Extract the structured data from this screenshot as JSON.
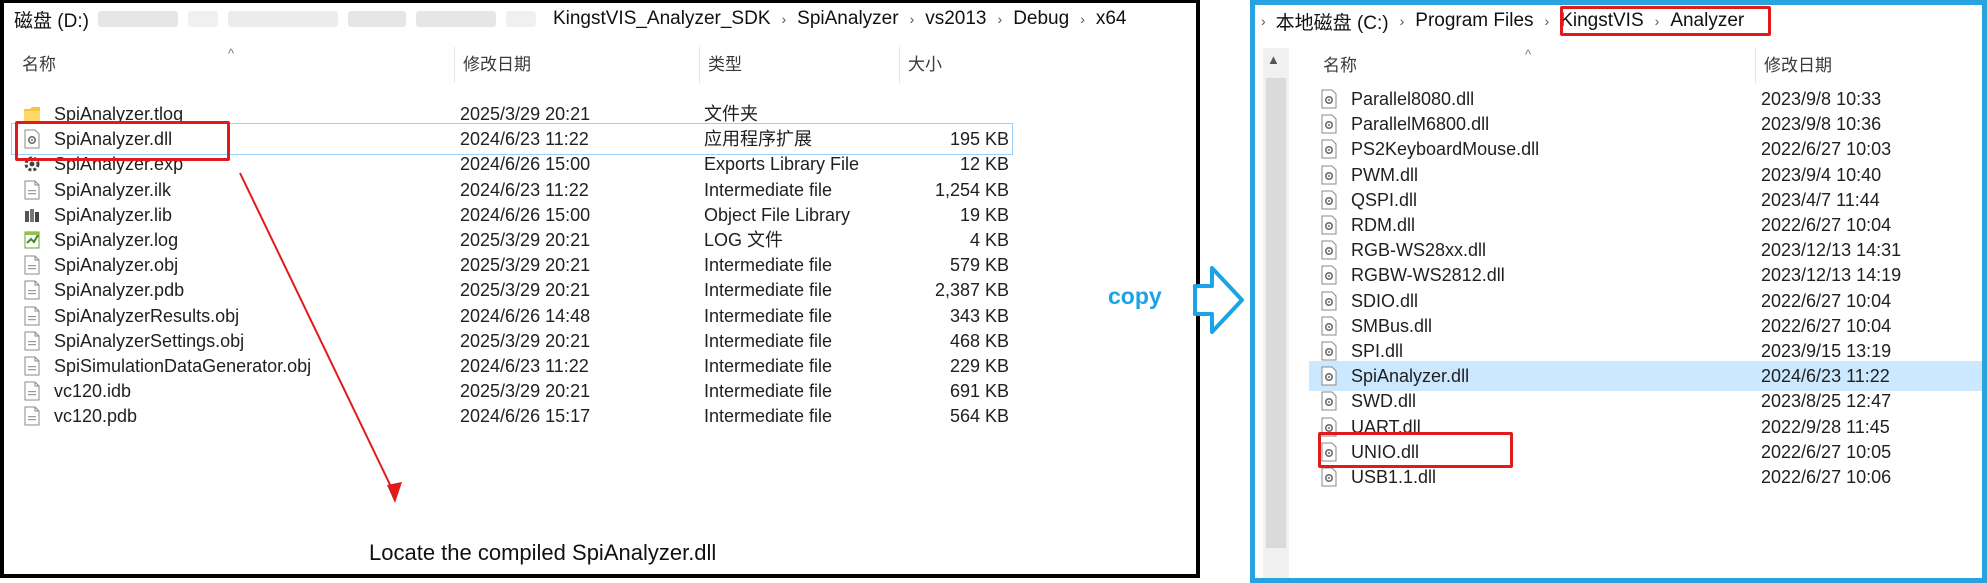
{
  "left": {
    "breadcrumb": [
      "磁盘 (D:)",
      "KingstVIS_Analyzer_SDK",
      "SpiAnalyzer",
      "vs2013",
      "Debug",
      "x64"
    ],
    "headers": {
      "name": "名称",
      "date": "修改日期",
      "type": "类型",
      "size": "大小"
    },
    "files": [
      {
        "name": "SpiAnalyzer.tlog",
        "date": "2025/3/29 20:21",
        "type": "文件夹",
        "size": "",
        "icon": "folder-icon"
      },
      {
        "name": "SpiAnalyzer.dll",
        "date": "2024/6/23 11:22",
        "type": "应用程序扩展",
        "size": "195 KB",
        "icon": "dll-file-icon"
      },
      {
        "name": "SpiAnalyzer.exp",
        "date": "2024/6/26 15:00",
        "type": "Exports Library File",
        "size": "12 KB",
        "icon": "exp-file-icon"
      },
      {
        "name": "SpiAnalyzer.ilk",
        "date": "2024/6/23 11:22",
        "type": "Intermediate file",
        "size": "1,254 KB",
        "icon": "generic-file-icon"
      },
      {
        "name": "SpiAnalyzer.lib",
        "date": "2024/6/26 15:00",
        "type": "Object File Library",
        "size": "19 KB",
        "icon": "lib-file-icon"
      },
      {
        "name": "SpiAnalyzer.log",
        "date": "2025/3/29 20:21",
        "type": "LOG 文件",
        "size": "4 KB",
        "icon": "log-file-icon"
      },
      {
        "name": "SpiAnalyzer.obj",
        "date": "2025/3/29 20:21",
        "type": "Intermediate file",
        "size": "579 KB",
        "icon": "generic-file-icon"
      },
      {
        "name": "SpiAnalyzer.pdb",
        "date": "2025/3/29 20:21",
        "type": "Intermediate file",
        "size": "2,387 KB",
        "icon": "generic-file-icon"
      },
      {
        "name": "SpiAnalyzerResults.obj",
        "date": "2024/6/26 14:48",
        "type": "Intermediate file",
        "size": "343 KB",
        "icon": "generic-file-icon"
      },
      {
        "name": "SpiAnalyzerSettings.obj",
        "date": "2025/3/29 20:21",
        "type": "Intermediate file",
        "size": "468 KB",
        "icon": "generic-file-icon"
      },
      {
        "name": "SpiSimulationDataGenerator.obj",
        "date": "2024/6/23 11:22",
        "type": "Intermediate file",
        "size": "229 KB",
        "icon": "generic-file-icon"
      },
      {
        "name": "vc120.idb",
        "date": "2025/3/29 20:21",
        "type": "Intermediate file",
        "size": "691 KB",
        "icon": "generic-file-icon"
      },
      {
        "name": "vc120.pdb",
        "date": "2024/6/26 15:17",
        "type": "Intermediate file",
        "size": "564 KB",
        "icon": "generic-file-icon"
      }
    ],
    "caption": "Locate the compiled SpiAnalyzer.dll"
  },
  "copy_label": "copy",
  "right": {
    "breadcrumb": [
      "本地磁盘 (C:)",
      "Program Files",
      "KingstVIS",
      "Analyzer"
    ],
    "headers": {
      "name": "名称",
      "date": "修改日期"
    },
    "files": [
      {
        "name": "Parallel8080.dll",
        "date": "2023/9/8 10:33"
      },
      {
        "name": "ParallelM6800.dll",
        "date": "2023/9/8 10:36"
      },
      {
        "name": "PS2KeyboardMouse.dll",
        "date": "2022/6/27 10:03"
      },
      {
        "name": "PWM.dll",
        "date": "2023/9/4 10:40"
      },
      {
        "name": "QSPI.dll",
        "date": "2023/4/7 11:44"
      },
      {
        "name": "RDM.dll",
        "date": "2022/6/27 10:04"
      },
      {
        "name": "RGB-WS28xx.dll",
        "date": "2023/12/13 14:31"
      },
      {
        "name": "RGBW-WS2812.dll",
        "date": "2023/12/13 14:19"
      },
      {
        "name": "SDIO.dll",
        "date": "2022/6/27 10:04"
      },
      {
        "name": "SMBus.dll",
        "date": "2022/6/27 10:04"
      },
      {
        "name": "SPI.dll",
        "date": "2023/9/15 13:19"
      },
      {
        "name": "SpiAnalyzer.dll",
        "date": "2024/6/23 11:22"
      },
      {
        "name": "SWD.dll",
        "date": "2023/8/25 12:47"
      },
      {
        "name": "UART.dll",
        "date": "2022/9/28 11:45"
      },
      {
        "name": "UNIO.dll",
        "date": "2022/6/27 10:05"
      },
      {
        "name": "USB1.1.dll",
        "date": "2022/6/27 10:06"
      }
    ]
  },
  "colors": {
    "highlight_red": "#e11b1b",
    "accent_blue": "#29a3e0",
    "selection": "#cce8ff"
  }
}
